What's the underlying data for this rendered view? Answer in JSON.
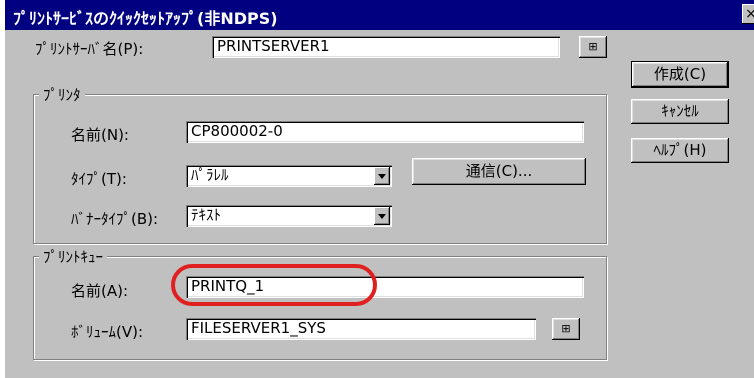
{
  "window": {
    "title": "ﾌﾟﾘﾝﾄｻｰﾋﾞｽのｸｲｯｸｾｯﾄｱｯﾌﾟ(非NDPS)",
    "close_glyph": "×"
  },
  "print_server": {
    "label": "ﾌﾟﾘﾝﾄｻｰﾊﾞ名(P):",
    "value": "PRINTSERVER1",
    "browse_icon": "browse-tree-icon"
  },
  "printer_group": {
    "caption": "ﾌﾟﾘﾝﾀ",
    "name_label": "名前(N):",
    "name_value": "CP800002-0",
    "type_label": "ﾀｲﾌﾟ(T):",
    "type_value": "ﾊﾟﾗﾚﾙ",
    "comm_button": "通信(C)...",
    "banner_label": "ﾊﾞﾅｰﾀｲﾌﾟ(B):",
    "banner_value": "ﾃｷｽﾄ"
  },
  "queue_group": {
    "caption": "ﾌﾟﾘﾝﾄｷｭｰ",
    "name_label": "名前(A):",
    "name_value": "PRINTQ_1",
    "volume_label": "ﾎﾞﾘｭｰﾑ(V):",
    "volume_value": "FILESERVER1_SYS",
    "browse_icon": "browse-tree-icon"
  },
  "buttons": {
    "create": "作成(C)",
    "cancel": "ｷｬﾝｾﾙ",
    "help": "ﾍﾙﾌﾟ(H)"
  },
  "colors": {
    "title_bar": "#000080",
    "dialog_face": "#c0c0c0",
    "annotation_highlight": "#e02020"
  }
}
